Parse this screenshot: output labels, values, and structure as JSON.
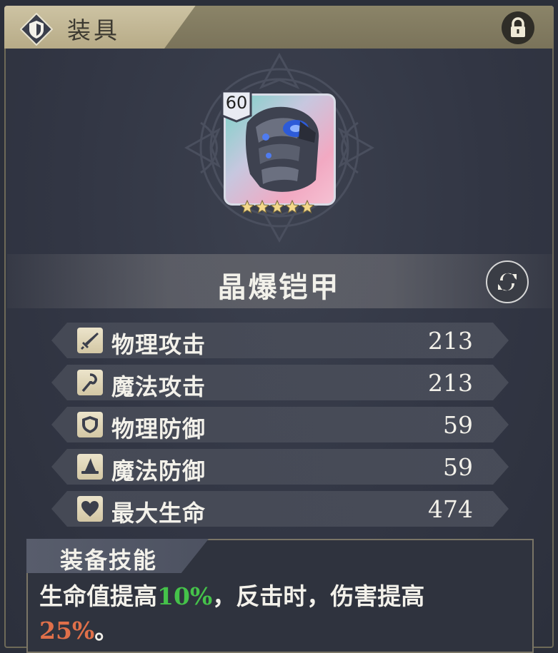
{
  "header": {
    "title": "装具",
    "icon": "shield-icon",
    "lock_icon": "lock-icon"
  },
  "item": {
    "level": "60",
    "name": "晶爆铠甲",
    "stars": 5
  },
  "stats": [
    {
      "icon": "sword-icon",
      "label": "物理攻击",
      "value": "213"
    },
    {
      "icon": "staff-icon",
      "label": "魔法攻击",
      "value": "213"
    },
    {
      "icon": "shield-icon",
      "label": "物理防御",
      "value": "59"
    },
    {
      "icon": "wizard-hat-icon",
      "label": "魔法防御",
      "value": "59"
    },
    {
      "icon": "heart-icon",
      "label": "最大生命",
      "value": "474"
    }
  ],
  "skill": {
    "title": "装备技能",
    "desc_part1": "生命值提高",
    "desc_val1": "10%",
    "desc_part2": "，反击时，伤害提高",
    "desc_val2": "25%",
    "desc_part3": "。"
  },
  "colors": {
    "highlight_green": "#45c24a",
    "highlight_orange": "#e0704a"
  }
}
